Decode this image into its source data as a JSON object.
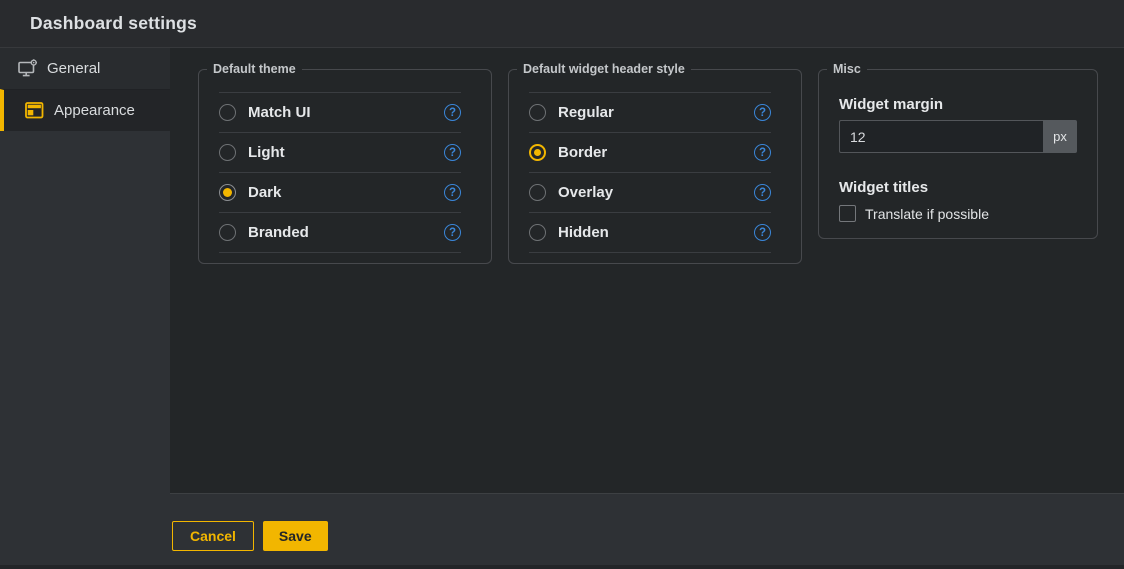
{
  "window": {
    "title": "Dashboard settings"
  },
  "sidebar": {
    "items": [
      {
        "label": "General",
        "icon": "monitor-settings-icon",
        "active": false
      },
      {
        "label": "Appearance",
        "icon": "appearance-layout-icon",
        "active": true
      }
    ]
  },
  "panels": [
    {
      "legend": "Default theme",
      "options": [
        {
          "label": "Match UI",
          "selected": false
        },
        {
          "label": "Light",
          "selected": false
        },
        {
          "label": "Dark",
          "selected": true
        },
        {
          "label": "Branded",
          "selected": false
        }
      ]
    },
    {
      "legend": "Default widget header style",
      "options": [
        {
          "label": "Regular",
          "selected": false
        },
        {
          "label": "Border",
          "selected": true
        },
        {
          "label": "Overlay",
          "selected": false
        },
        {
          "label": "Hidden",
          "selected": false
        }
      ]
    }
  ],
  "misc": {
    "legend": "Misc",
    "widget_margin_label": "Widget margin",
    "widget_margin_value": "12",
    "widget_margin_unit": "px",
    "widget_titles_label": "Widget titles",
    "translate_checkbox_label": "Translate if possible",
    "translate_checked": false
  },
  "footer": {
    "cancel_label": "Cancel",
    "save_label": "Save"
  },
  "colors": {
    "accent": "#f2b600",
    "help_icon": "#3a86d8",
    "content_bg": "#232628",
    "chrome_bg": "#2e3135"
  }
}
